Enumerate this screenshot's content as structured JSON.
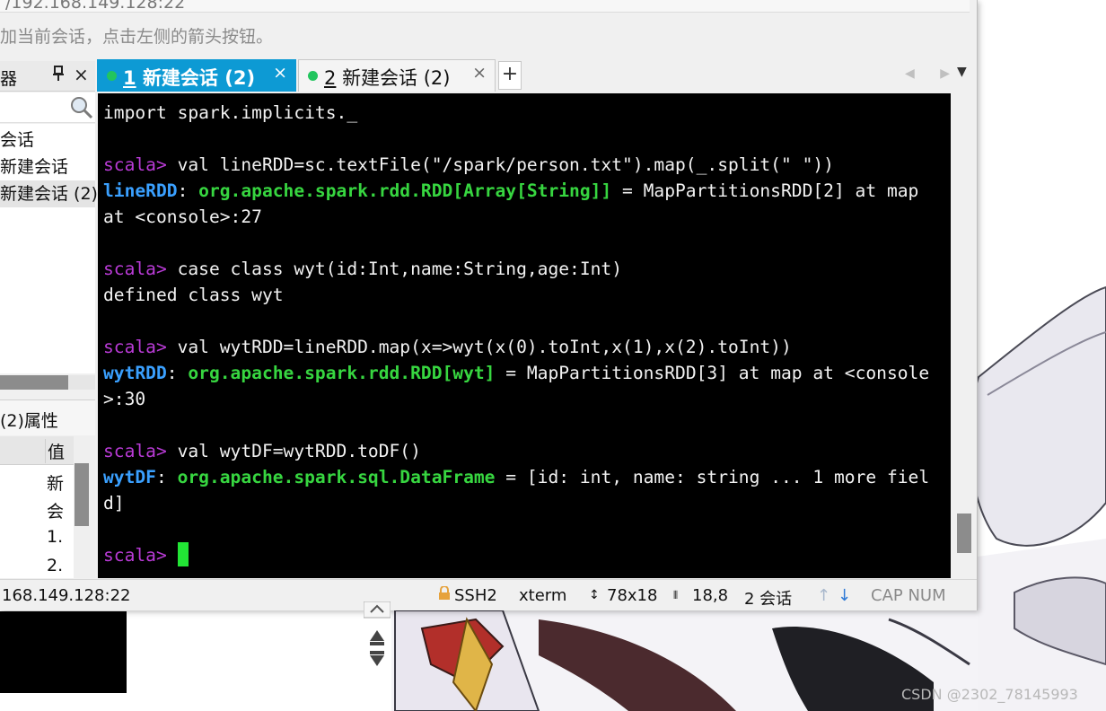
{
  "window": {
    "hint_text": "加当前会话，点击左侧的箭头按钮。"
  },
  "session_manager": {
    "title": "器",
    "pin_icon": "pin-icon",
    "close_label": "×",
    "items": [
      {
        "label": "会话"
      },
      {
        "label": "新建会话"
      },
      {
        "label": "新建会话 (2)"
      }
    ]
  },
  "properties": {
    "title": "(2)属性",
    "value_header": "值",
    "cells": [
      "新",
      "会",
      "1.",
      "2."
    ]
  },
  "tabs": [
    {
      "num": "1",
      "label": "新建会话 (2)",
      "active": true
    },
    {
      "num": "2",
      "label": "新建会话 (2)",
      "active": false
    }
  ],
  "new_tab_label": "+",
  "nav_arrows_label": "◀ ▶",
  "tab_menu_label": "▼",
  "terminal": {
    "lines": [
      [
        {
          "t": "import spark.implicits._",
          "c": ""
        }
      ],
      [],
      [
        {
          "t": "scala>",
          "c": "p"
        },
        {
          "t": " val lineRDD=sc.textFile(\"/spark/person.txt\").map(_.split(\" \"))",
          "c": ""
        }
      ],
      [
        {
          "t": "lineRDD",
          "c": "var"
        },
        {
          "t": ": ",
          "c": ""
        },
        {
          "t": "org.apache.spark.rdd.RDD[Array[String]]",
          "c": "typ"
        },
        {
          "t": " = MapPartitionsRDD[2] at map",
          "c": ""
        }
      ],
      [
        {
          "t": "at <console>:27",
          "c": ""
        }
      ],
      [],
      [
        {
          "t": "scala>",
          "c": "p"
        },
        {
          "t": " case class wyt(id:Int,name:String,age:Int)",
          "c": ""
        }
      ],
      [
        {
          "t": "defined class wyt",
          "c": ""
        }
      ],
      [],
      [
        {
          "t": "scala>",
          "c": "p"
        },
        {
          "t": " val wytRDD=lineRDD.map(x=>wyt(x(0).toInt,x(1),x(2).toInt))",
          "c": ""
        }
      ],
      [
        {
          "t": "wytRDD",
          "c": "var"
        },
        {
          "t": ": ",
          "c": ""
        },
        {
          "t": "org.apache.spark.rdd.RDD[wyt]",
          "c": "typ"
        },
        {
          "t": " = MapPartitionsRDD[3] at map at <console",
          "c": ""
        }
      ],
      [
        {
          "t": ">:30",
          "c": ""
        }
      ],
      [],
      [
        {
          "t": "scala>",
          "c": "p"
        },
        {
          "t": " val wytDF=wytRDD.toDF()",
          "c": ""
        }
      ],
      [
        {
          "t": "wytDF",
          "c": "var"
        },
        {
          "t": ": ",
          "c": ""
        },
        {
          "t": "org.apache.spark.sql.DataFrame",
          "c": "typ"
        },
        {
          "t": " = [id: int, name: string ... 1 more fiel",
          "c": ""
        }
      ],
      [
        {
          "t": "d]",
          "c": ""
        }
      ],
      [],
      [
        {
          "t": "scala>",
          "c": "p"
        },
        {
          "t": " ",
          "c": ""
        }
      ]
    ],
    "colors": {
      "prompt": "#b93bd6",
      "variable": "#3aa0ff",
      "type": "#37d640",
      "cursor": "#22e535"
    }
  },
  "statusbar": {
    "host": "168.149.128:22",
    "protocol": "SSH2",
    "term": "xterm",
    "size": "78x18",
    "cursor_pos": "18,8",
    "sessions": "2 会话",
    "capnum": "CAP NUM",
    "lock_icon": "lock-icon",
    "size_icon": "resize-icon",
    "pos_icon": "cursor-position-icon",
    "up_down_icon": "transfer-arrows-icon"
  },
  "watermark": "CSDN @2302_78145993",
  "accent": "#0d9ad4"
}
